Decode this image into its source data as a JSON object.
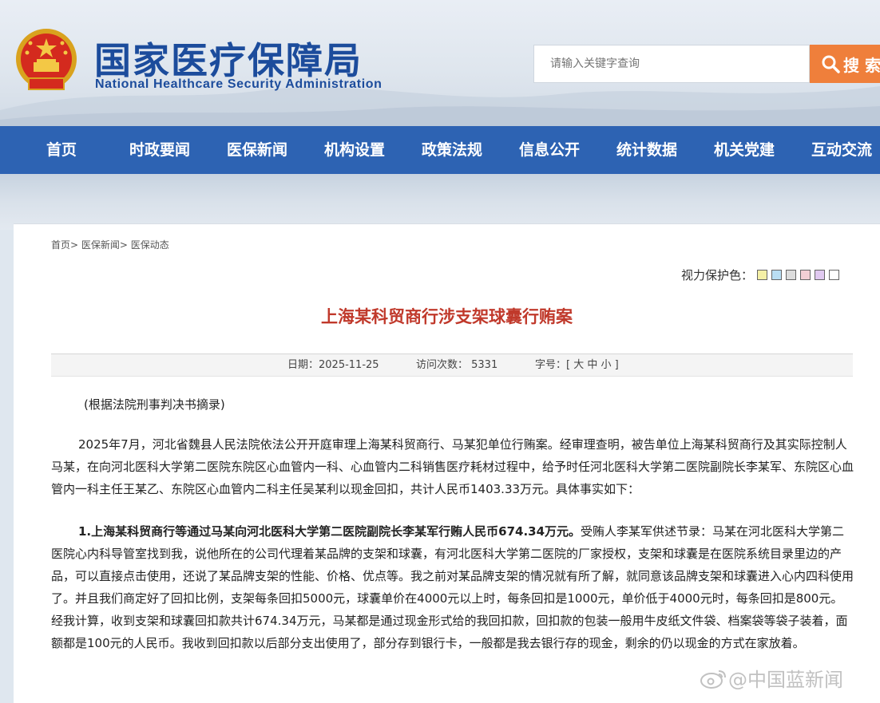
{
  "header": {
    "title_cn": "国家医疗保障局",
    "title_en": "National Healthcare Security Administration",
    "search_placeholder": "请输入关键字查询",
    "search_button": "搜 索"
  },
  "nav": [
    "首页",
    "时政要闻",
    "医保新闻",
    "机构设置",
    "政策法规",
    "信息公开",
    "统计数据",
    "机关党建",
    "互动交流"
  ],
  "breadcrumb": [
    "首页>",
    "医保新闻>",
    "医保动态"
  ],
  "vision": {
    "label": "视力保护色：",
    "swatches": [
      "#f5f0a6",
      "#b9def3",
      "#dcdcdc",
      "#f3cfd4",
      "#e0c9f0",
      "#ffffff"
    ]
  },
  "article": {
    "title": "上海某科贸商行涉支架球囊行贿案",
    "date": "日期：2025-11-25",
    "visits": "访问次数： 5331",
    "fontsize": "字号：[ 大 中 小 ]",
    "source_note": "(根据法院刑事判决书摘录)",
    "para1": "2025年7月，河北省魏县人民法院依法公开开庭审理上海某科贸商行、马某犯单位行贿案。经审理查明，被告单位上海某科贸商行及其实际控制人马某，在向河北医科大学第二医院东院区心血管内一科、心血管内二科销售医疗耗材过程中，给予时任河北医科大学第二医院副院长李某军、东院区心血管内一科主任王某乙、东院区心血管内二科主任吴某利以现金回扣，共计人民币1403.33万元。具体事实如下：",
    "para2_bold": "1.上海某科贸商行等通过马某向河北医科大学第二医院副院长李某军行贿人民币674.34万元。",
    "para2_rest": "受贿人李某军供述节录：马某在河北医科大学第二医院心内科导管室找到我，说他所在的公司代理着某品牌的支架和球囊，有河北医科大学第二医院的厂家授权，支架和球囊是在医院系统目录里边的产品，可以直接点击使用，还说了某品牌支架的性能、价格、优点等。我之前对某品牌支架的情况就有所了解，就同意该品牌支架和球囊进入心内四科使用了。并且我们商定好了回扣比例，支架每条回扣5000元，球囊单价在4000元以上时，每条回扣是1000元，单价低于4000元时，每条回扣是800元。经我计算，收到支架和球囊回扣款共计674.34万元，马某都是通过现金形式给的我回扣款，回扣款的包装一般用牛皮纸文件袋、档案袋等袋子装着，面额都是100元的人民币。我收到回扣款以后部分支出使用了，部分存到银行卡，一般都是我去银行存的现金，剩余的仍以现金的方式在家放着。"
  },
  "watermark": "@中国蓝新闻"
}
